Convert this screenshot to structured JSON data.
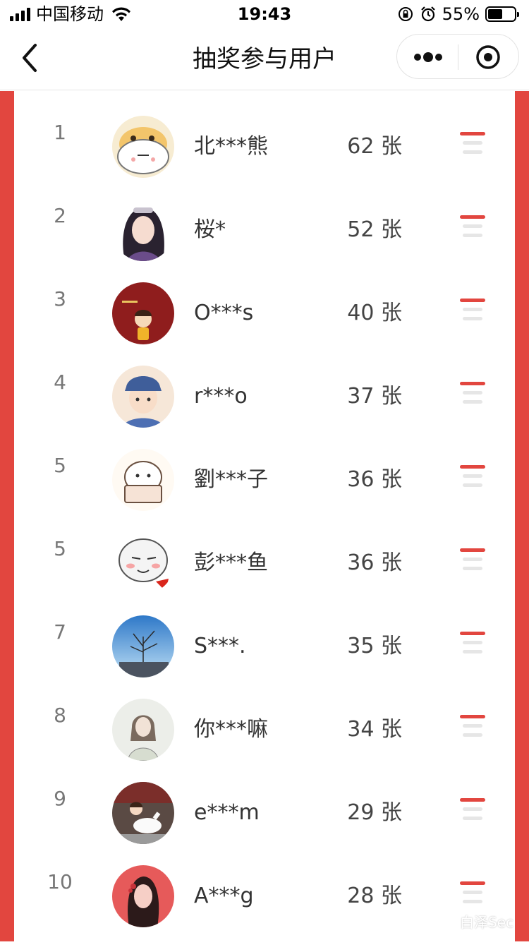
{
  "status": {
    "carrier": "中国移动",
    "time": "19:43",
    "battery": "55%"
  },
  "nav": {
    "title": "抽奖参与用户"
  },
  "colors": {
    "accent": "#e2463f",
    "menu_top": "#e2463f",
    "menu_lines": "#e6e6e6"
  },
  "participants": [
    {
      "rank": "1",
      "name": "北***熊",
      "count": "62 张"
    },
    {
      "rank": "2",
      "name": "桜*",
      "count": "52 张"
    },
    {
      "rank": "3",
      "name": "O***s",
      "count": "40 张"
    },
    {
      "rank": "4",
      "name": "r***o",
      "count": "37 张"
    },
    {
      "rank": "5",
      "name": "劉***子",
      "count": "36 张"
    },
    {
      "rank": "5",
      "name": "彭***鱼",
      "count": "36 张"
    },
    {
      "rank": "7",
      "name": "S***.",
      "count": "35 张"
    },
    {
      "rank": "8",
      "name": "你***嘛",
      "count": "34 张"
    },
    {
      "rank": "9",
      "name": "e***m",
      "count": "29 张"
    },
    {
      "rank": "10",
      "name": "A***g",
      "count": "28 张"
    }
  ],
  "watermark": "白泽Sec"
}
